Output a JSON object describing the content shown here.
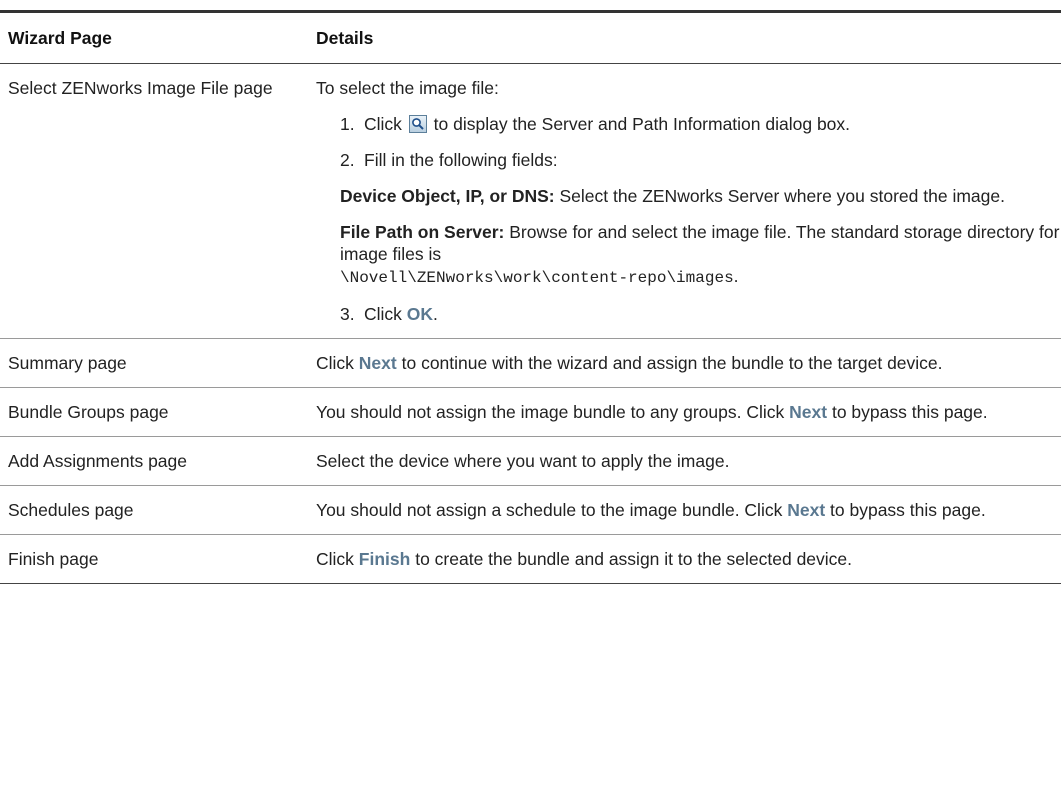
{
  "table": {
    "headers": [
      "Wizard Page",
      "Details"
    ],
    "rows": [
      {
        "page": "Select ZENworks Image File page",
        "intro": "To select the image file:",
        "steps": [
          {
            "num": "1.",
            "pre": "Click",
            "post": "to display the Server and Path Information dialog box.",
            "icon": "search-icon"
          },
          {
            "num": "2.",
            "text": "Fill in the following fields:"
          },
          {
            "num": "3.",
            "pre": "Click",
            "term": "OK",
            "post": "."
          }
        ],
        "fields": [
          {
            "label": "Device Object, IP, or DNS:",
            "text": "Select the ZENworks Server where you stored the image."
          },
          {
            "label": "File Path on Server:",
            "text": "Browse for and select the image file. The standard storage directory for image files is",
            "path": "\\Novell\\ZENworks\\work\\content-repo\\images",
            "end": "."
          }
        ]
      },
      {
        "page": "Summary page",
        "pre": "Click",
        "term": "Next",
        "post": "to continue with the wizard and assign the bundle to the target device."
      },
      {
        "page": "Bundle Groups page",
        "pre": "You should not assign the image bundle to any groups. Click",
        "term": "Next",
        "post": "to bypass this page."
      },
      {
        "page": "Add Assignments page",
        "text": "Select the device where you want to apply the image."
      },
      {
        "page": "Schedules page",
        "pre": "You should not assign a schedule to the image bundle. Click",
        "term": "Next",
        "post": "to bypass this page."
      },
      {
        "page": "Finish page",
        "pre": "Click",
        "term": "Finish",
        "post": "to create the bundle and assign it to the selected device."
      }
    ]
  },
  "colors": {
    "ui_term": "#5a7890",
    "rule": "#333333"
  }
}
